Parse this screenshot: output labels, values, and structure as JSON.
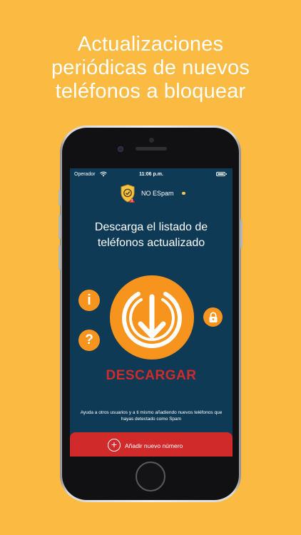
{
  "headline": {
    "line1": "Actualizaciones",
    "line2": "periódicas de nuevos",
    "line3": "teléfonos a bloquear"
  },
  "statusbar": {
    "carrier": "Operador",
    "time": "11:06 p.m."
  },
  "app": {
    "brand_name": "NO ESpam"
  },
  "main": {
    "title_line1": "Descarga el listado de",
    "title_line2": "teléfonos actualizado",
    "info_glyph": "i",
    "help_glyph": "?",
    "download_label": "DESCARGAR",
    "help_text": "Ayuda a otros usuarios y a ti mismo añadiendo nuevos teléfonos que hayas detectado como Spam",
    "add_label": "Añadir nuevo número",
    "add_glyph": "+"
  },
  "colors": {
    "background": "#fbbb42",
    "screen": "#0e3a56",
    "accent_orange": "#f7941e",
    "accent_red": "#d12a2a"
  },
  "icons": [
    "wifi-icon",
    "battery-icon",
    "shield-check-icon",
    "info-icon",
    "help-icon",
    "lock-icon",
    "download-icon",
    "add-circle-icon"
  ]
}
